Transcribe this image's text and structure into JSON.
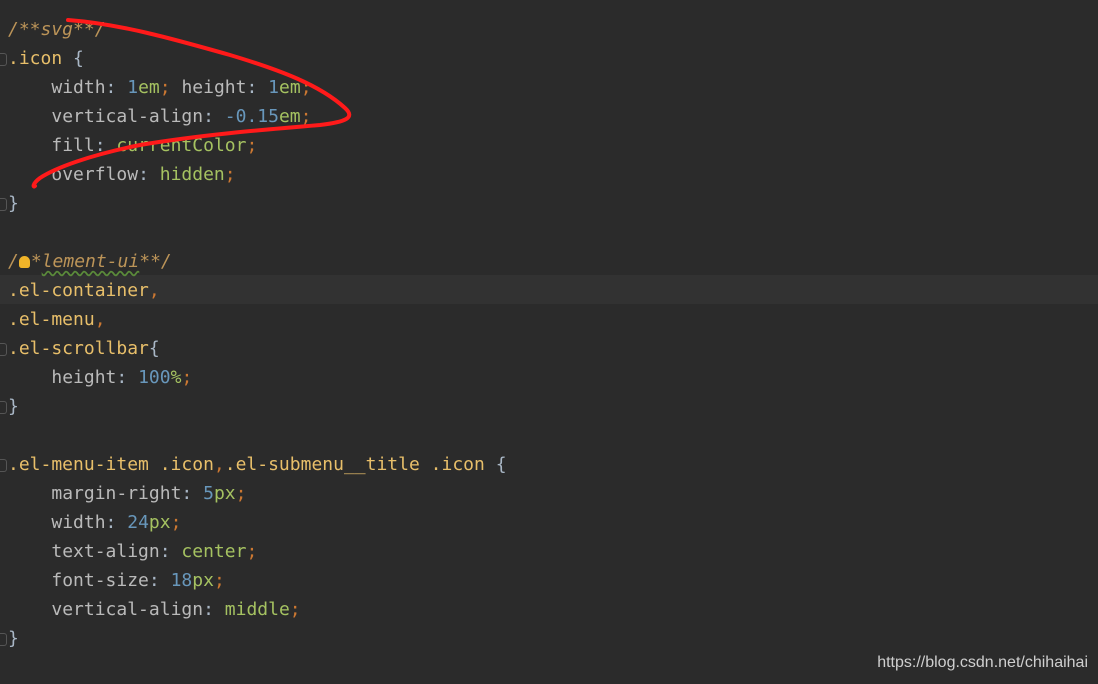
{
  "editor": {
    "background": "#2b2b2b",
    "highlighted_line": 9,
    "lines": [
      [
        [
          "/**svg**/",
          "c"
        ]
      ],
      [
        [
          ".icon ",
          "s"
        ],
        [
          "{",
          "b"
        ]
      ],
      [
        [
          "    ",
          "o"
        ],
        [
          "width",
          "p"
        ],
        [
          ": ",
          "o"
        ],
        [
          "1",
          "n"
        ],
        [
          "em",
          "u"
        ],
        [
          ";",
          "x"
        ],
        [
          " ",
          "o"
        ],
        [
          "height",
          "p"
        ],
        [
          ": ",
          "o"
        ],
        [
          "1",
          "n"
        ],
        [
          "em",
          "u"
        ],
        [
          ";",
          "x"
        ]
      ],
      [
        [
          "    ",
          "o"
        ],
        [
          "vertical-align",
          "p"
        ],
        [
          ": ",
          "o"
        ],
        [
          "-0.15",
          "n"
        ],
        [
          "em",
          "u"
        ],
        [
          ";",
          "x"
        ]
      ],
      [
        [
          "    ",
          "o"
        ],
        [
          "fill",
          "p"
        ],
        [
          ": ",
          "o"
        ],
        [
          "currentColor",
          "k"
        ],
        [
          ";",
          "x"
        ]
      ],
      [
        [
          "    ",
          "o"
        ],
        [
          "overflow",
          "p"
        ],
        [
          ": ",
          "o"
        ],
        [
          "hidden",
          "k"
        ],
        [
          ";",
          "x"
        ]
      ],
      [
        [
          "}",
          "b"
        ]
      ],
      [],
      [
        [
          "/",
          "c"
        ],
        [
          "*",
          "bulb"
        ],
        [
          "*",
          "c"
        ],
        [
          "lement-ui",
          "w"
        ],
        [
          "**/",
          "c"
        ]
      ],
      [
        [
          ".el-container",
          "s"
        ],
        [
          ",",
          "x"
        ]
      ],
      [
        [
          ".el-menu",
          "s"
        ],
        [
          ",",
          "x"
        ]
      ],
      [
        [
          ".el-scrollbar",
          "s"
        ],
        [
          "{",
          "b"
        ]
      ],
      [
        [
          "    ",
          "o"
        ],
        [
          "height",
          "p"
        ],
        [
          ": ",
          "o"
        ],
        [
          "100",
          "n"
        ],
        [
          "%",
          "u"
        ],
        [
          ";",
          "x"
        ]
      ],
      [
        [
          "}",
          "b"
        ]
      ],
      [],
      [
        [
          ".el-menu-item .icon",
          "s"
        ],
        [
          ",",
          "x"
        ],
        [
          ".el-submenu__title .icon ",
          "s"
        ],
        [
          "{",
          "b"
        ]
      ],
      [
        [
          "    ",
          "o"
        ],
        [
          "margin-right",
          "p"
        ],
        [
          ": ",
          "o"
        ],
        [
          "5",
          "n"
        ],
        [
          "px",
          "u"
        ],
        [
          ";",
          "x"
        ]
      ],
      [
        [
          "    ",
          "o"
        ],
        [
          "width",
          "p"
        ],
        [
          ": ",
          "o"
        ],
        [
          "24",
          "n"
        ],
        [
          "px",
          "u"
        ],
        [
          ";",
          "x"
        ]
      ],
      [
        [
          "    ",
          "o"
        ],
        [
          "text-align",
          "p"
        ],
        [
          ": ",
          "o"
        ],
        [
          "center",
          "k"
        ],
        [
          ";",
          "x"
        ]
      ],
      [
        [
          "    ",
          "o"
        ],
        [
          "font-size",
          "p"
        ],
        [
          ": ",
          "o"
        ],
        [
          "18",
          "n"
        ],
        [
          "px",
          "u"
        ],
        [
          ";",
          "x"
        ]
      ],
      [
        [
          "    ",
          "o"
        ],
        [
          "vertical-align",
          "p"
        ],
        [
          ": ",
          "o"
        ],
        [
          "middle",
          "k"
        ],
        [
          ";",
          "x"
        ]
      ],
      [
        [
          "}",
          "b"
        ]
      ]
    ],
    "fold_lines": [
      1,
      6,
      11,
      13,
      15,
      21
    ]
  },
  "annotation": {
    "color": "#ff1a1a"
  },
  "watermark": "https://blog.csdn.net/chihaihai"
}
